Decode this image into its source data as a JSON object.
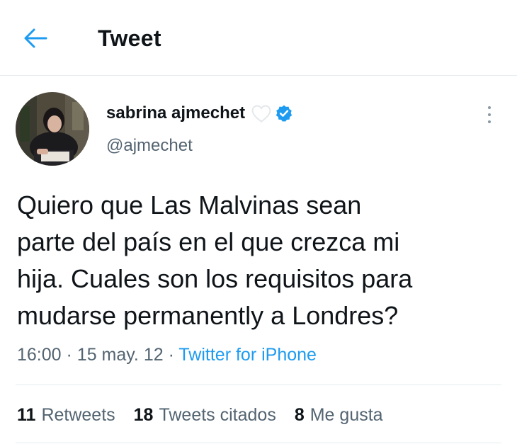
{
  "header": {
    "title": "Tweet"
  },
  "author": {
    "name": "sabrina ajmechet",
    "handle": "@ajmechet"
  },
  "tweet": {
    "lines": [
      "Quiero que Las Malvinas sean",
      "parte del país en el que crezca mi",
      "hija. Cuales son los requisitos para",
      "mudarse permanently a Londres?"
    ],
    "time": "16:00",
    "date": "15 may. 12",
    "separator": "·",
    "source": "Twitter for iPhone"
  },
  "stats": {
    "retweets": {
      "count": "11",
      "label": "Retweets"
    },
    "quotes": {
      "count": "18",
      "label": "Tweets citados"
    },
    "likes": {
      "count": "8",
      "label": "Me gusta"
    }
  },
  "colors": {
    "accent": "#1d9bf0",
    "secondary_text": "#536471",
    "divider": "#e6ecf0"
  },
  "icons": [
    "back-arrow-icon",
    "white-heart-icon",
    "verified-badge-icon",
    "more-options-icon"
  ]
}
